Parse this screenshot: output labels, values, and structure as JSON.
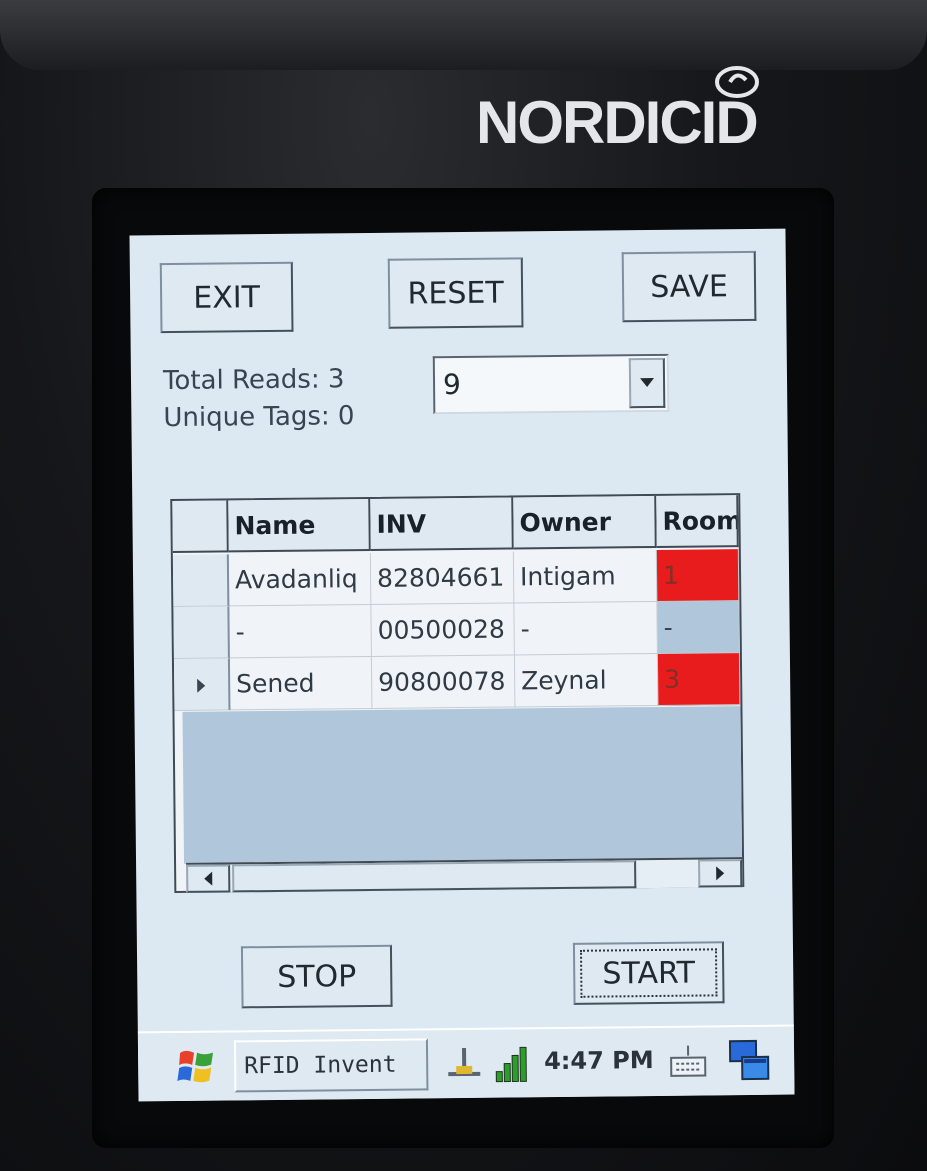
{
  "device": {
    "brand": "NORDICID"
  },
  "toolbar": {
    "exit_label": "EXIT",
    "reset_label": "RESET",
    "save_label": "SAVE"
  },
  "stats": {
    "total_reads": "Total Reads: 3",
    "unique_tags": "Unique Tags: 0"
  },
  "room_select": {
    "value": "9"
  },
  "grid": {
    "columns": [
      "Name",
      "INV",
      "Owner",
      "Room"
    ],
    "rows": [
      {
        "name": "Avadanliq",
        "inv": "82804661",
        "owner": "Intigam",
        "room": "1",
        "room_color": "#e81c1c",
        "selected": false
      },
      {
        "name": "-",
        "inv": "00500028",
        "owner": "-",
        "room": "-",
        "room_color": "#b0c6da",
        "selected": false
      },
      {
        "name": "Sened",
        "inv": "90800078",
        "owner": "Zeynal",
        "room": "3",
        "room_color": "#e81c1c",
        "selected": true
      }
    ]
  },
  "actions": {
    "stop_label": "STOP",
    "start_label": "START"
  },
  "taskbar": {
    "app_title": "RFID Invent",
    "time": "4:47 PM",
    "icons": [
      "windows-start-icon",
      "usb-connection-icon",
      "signal-strength-icon",
      "keyboard-icon",
      "desktop-icon"
    ]
  },
  "colors": {
    "screen_bg": "#dce8f2",
    "room_alert": "#e81c1c",
    "empty_area": "#b0c6da"
  }
}
